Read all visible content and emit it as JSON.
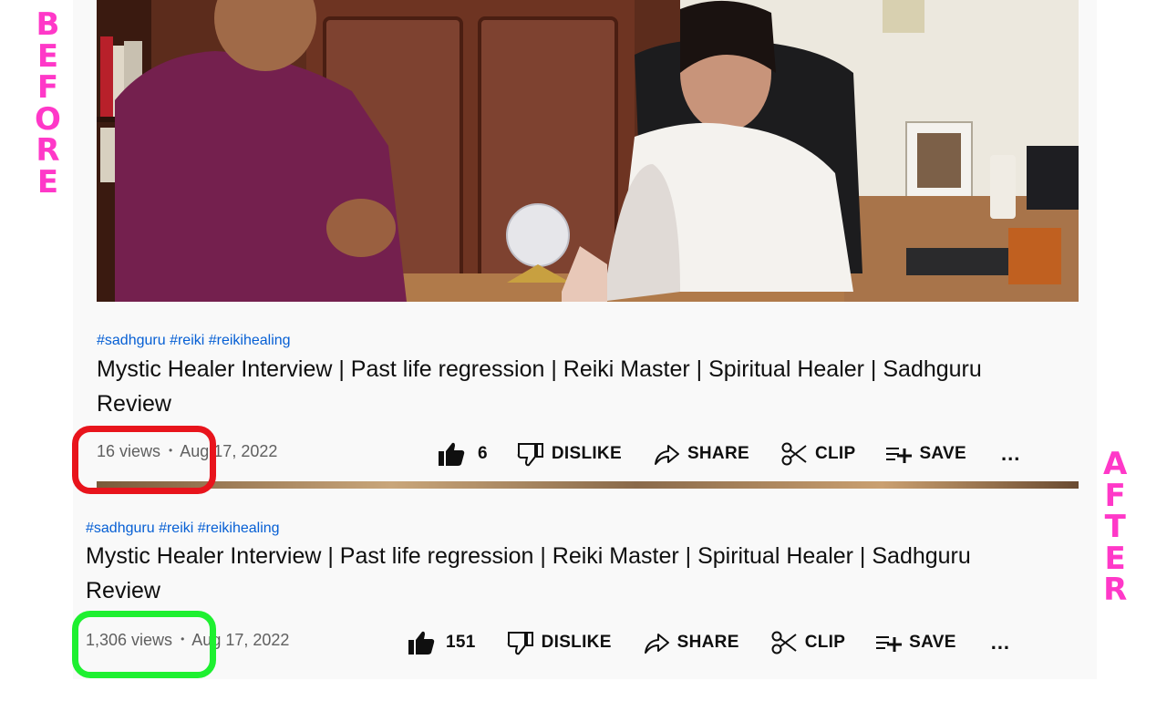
{
  "before_label": [
    "B",
    "E",
    "F",
    "O",
    "R",
    "E"
  ],
  "after_label": [
    "A",
    "F",
    "T",
    "E",
    "R"
  ],
  "before": {
    "hashtags": "#sadhguru #reiki #reikihealing",
    "title_line1": "Mystic Healer Interview | Past life regression | Reiki Master | Spiritual Healer | Sadhguru",
    "title_line2": "Review",
    "views": "16 views",
    "separator": "•",
    "date": "Aug 17, 2022",
    "like_count": "6",
    "dislike_label": "DISLIKE",
    "share_label": "SHARE",
    "clip_label": "CLIP",
    "save_label": "SAVE",
    "more_label": "..."
  },
  "after": {
    "hashtags": "#sadhguru #reiki #reikihealing",
    "title_line1": "Mystic Healer Interview | Past life regression | Reiki Master | Spiritual Healer | Sadhguru",
    "title_line2": "Review",
    "views": "1,306 views",
    "separator": "•",
    "date": "Aug 17, 2022",
    "like_count": "151",
    "dislike_label": "DISLIKE",
    "share_label": "SHARE",
    "clip_label": "CLIP",
    "save_label": "SAVE",
    "more_label": "..."
  },
  "icons": {
    "like": "thumbs-up-icon",
    "dislike": "thumbs-down-icon",
    "share": "share-arrow-icon",
    "clip": "scissors-icon",
    "save": "playlist-add-icon",
    "more": "more-horizontal-icon"
  },
  "colors": {
    "label_pink": "#ff38c8",
    "highlight_red": "#e8141c",
    "highlight_green": "#1ef030",
    "hashtag_blue": "#065fd4",
    "meta_gray": "#606060"
  }
}
